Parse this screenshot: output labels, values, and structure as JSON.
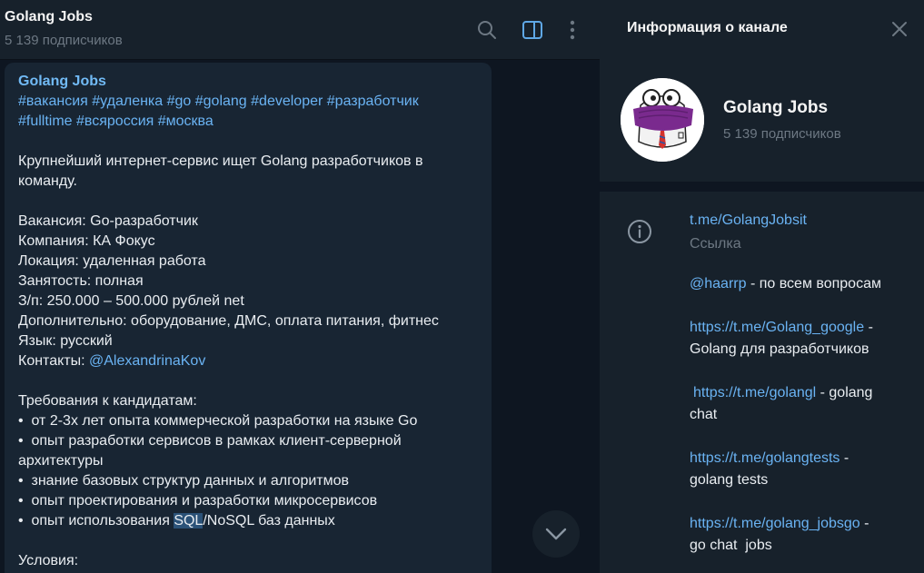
{
  "header": {
    "title": "Golang Jobs",
    "subscribers": "5 139 подписчиков"
  },
  "message": {
    "channel": "Golang Jobs",
    "tags_line1": "#вакансия #удаленка #go #golang #developer #разработчик",
    "tags_line2": "#fulltime #всяроссия #москва",
    "intro1": "Крупнейший интернет-сервис ищет Golang разработчиков в",
    "intro2": "команду.",
    "vacancy": "Вакансия: Go-разработчик",
    "company": "Компания: КА Фокус",
    "location": "Локация: удаленная работа",
    "employment": "Занятость: полная",
    "salary": "З/п: 250.000 – 500.000 рублей net",
    "extra": "Дополнительно: оборудование, ДМС, оплата питания, фитнес",
    "language": "Язык: русский",
    "contacts_label": "Контакты: ",
    "contacts_link": "@AlexandrinaKov",
    "req_title": "Требования к кандидатам:",
    "req1": "•  от 2-3х лет опыта коммерческой разработки на языке Go",
    "req2a": "•  опыт разработки сервисов в рамках клиент-серверной",
    "req2b": "архитектуры",
    "req3": "•  знание базовых структур данных и алгоритмов",
    "req4": "•  опыт проектирования и разработки микросервисов",
    "req5_pre": "•  опыт использования ",
    "req5_hl": "SQL",
    "req5_post": "/NoSQL баз данных",
    "conditions": "Условия:"
  },
  "info": {
    "title": "Информация о канале",
    "name": "Golang Jobs",
    "subscribers": "5 139 подписчиков",
    "link": "t.me/GolangJobsit",
    "link_label": "Ссылка",
    "d1_link": "@haarrp",
    "d1_text": " - по всем вопросам",
    "d2_link": "https://t.me/Golang_google",
    "d2_text": " -",
    "d2_text2": "Golang для разработчиков",
    "d3_link": "https://t.me/golangl",
    "d3_text": " - golang",
    "d3_text2": "chat",
    "d4_link": "https://t.me/golangtests",
    "d4_text": " -",
    "d4_text2": "golang tests",
    "d5_link": "https://t.me/golang_jobsgo",
    "d5_text": " -",
    "d5_text2": "go chat  jobs"
  },
  "icons": {
    "search": "search-icon",
    "panel": "sidebar-toggle-icon",
    "more": "more-vertical-icon",
    "close": "close-icon",
    "info": "info-icon",
    "scroll": "chevron-down-icon"
  },
  "colors": {
    "accent": "#6ab3f3",
    "bg_chat": "#0e1621",
    "bg_panel": "#17212b",
    "bubble": "#182533"
  }
}
